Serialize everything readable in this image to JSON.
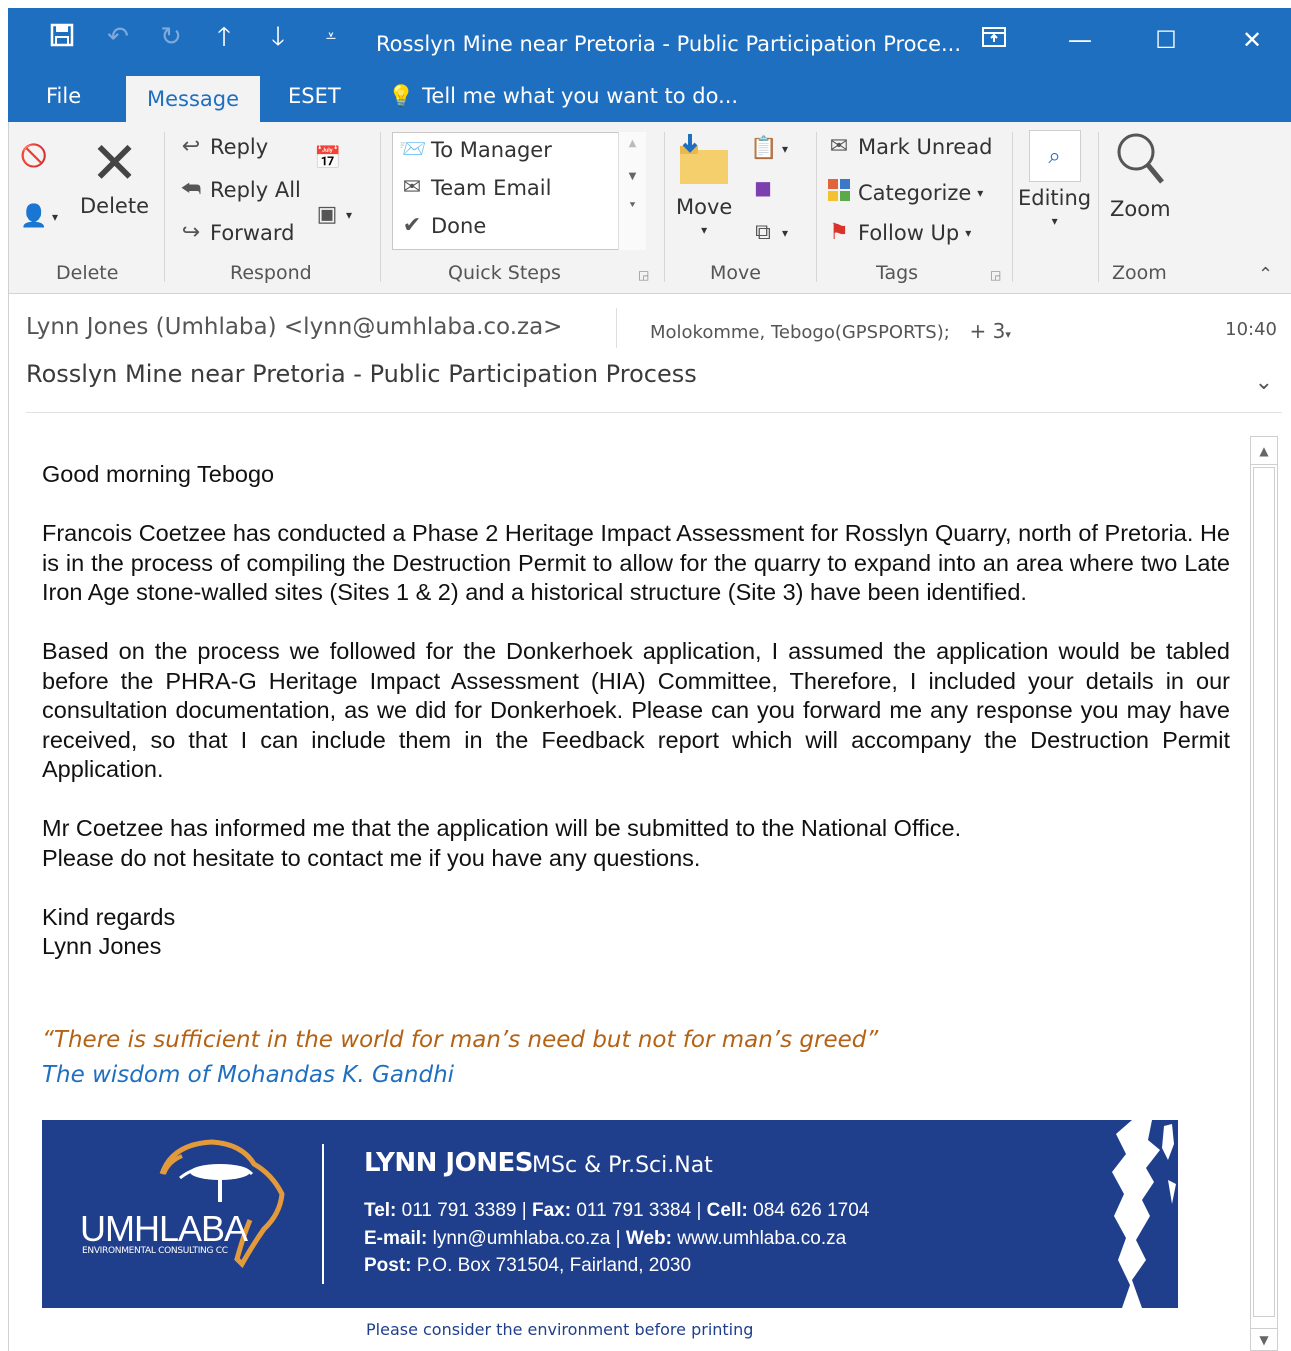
{
  "window": {
    "title": "Rosslyn Mine near Pretoria - Public Participation Proce...",
    "quick_access": [
      "save-icon",
      "undo-icon",
      "redo-icon",
      "up-arrow-icon",
      "down-arrow-icon",
      "customize-icon"
    ]
  },
  "tabs": {
    "file": "File",
    "message": "Message",
    "eset": "ESET",
    "tellme": "Tell me what you want to do..."
  },
  "ribbon": {
    "delete": {
      "delete_label": "Delete",
      "group": "Delete"
    },
    "respond": {
      "reply": "Reply",
      "reply_all": "Reply All",
      "forward": "Forward",
      "group": "Respond"
    },
    "quick_steps": {
      "items": [
        "To Manager",
        "Team Email",
        "Done"
      ],
      "group": "Quick Steps"
    },
    "move": {
      "move_label": "Move",
      "group": "Move"
    },
    "tags": {
      "mark_unread": "Mark Unread",
      "categorize": "Categorize",
      "follow_up": "Follow Up",
      "group": "Tags"
    },
    "editing": {
      "label": "Editing"
    },
    "zoom": {
      "label": "Zoom",
      "group": "Zoom"
    }
  },
  "header": {
    "sender": "Lynn Jones (Umhlaba) <lynn@umhlaba.co.za>",
    "recipients": "Molokomme, Tebogo(GPSPORTS);",
    "more_recipients": "+ 3",
    "time": "10:40",
    "subject": "Rosslyn Mine near Pretoria - Public Participation Process"
  },
  "body": {
    "greeting": "Good morning Tebogo",
    "para1": "Francois Coetzee has conducted a Phase 2 Heritage Impact Assessment for Rosslyn Quarry, north of Pretoria.  He is in the process of compiling the Destruction Permit to allow for the quarry to expand into an area where two Late Iron Age stone-walled sites (Sites 1 & 2) and a historical structure (Site 3) have been identified.",
    "para2": "Based on the process we followed for the Donkerhoek application, I assumed the application would be tabled before the PHRA-G Heritage Impact Assessment (HIA) Committee, Therefore, I included your details in our consultation documentation, as we did for Donkerhoek.  Please can you forward me any response you may have received, so that I can include them in the Feedback report which will accompany the Destruction Permit Application.",
    "para3_line1": "Mr Coetzee has informed me that the application will be submitted to the National Office.",
    "para3_line2": "Please do not hesitate to contact me if you have any questions.",
    "closing": "Kind regards",
    "signoff": "Lynn Jones",
    "quote": "“There is sufficient in the world for man’s need but not for man’s greed”",
    "quote_attr": "The wisdom of Mohandas K. Gandhi"
  },
  "signature": {
    "logo_text": "UMHLABA",
    "logo_sub": "ENVIRONMENTAL CONSULTING CC",
    "name": "LYNN JONES",
    "credentials": "MSc & Pr.Sci.Nat",
    "tel_label": "Tel:",
    "tel": "011 791 3389",
    "fax_label": "Fax:",
    "fax": "011 791 3384",
    "cell_label": "Cell:",
    "cell": "084 626 1704",
    "email_label": "E-mail:",
    "email": "lynn@umhlaba.co.za",
    "web_label": "Web:",
    "web": "www.umhlaba.co.za",
    "post_label": "Post:",
    "post": "P.O. Box 731504, Fairland, 2030",
    "sep": "|",
    "footer": "Please consider the environment before printing"
  },
  "colors": {
    "accent": "#1f6fc1",
    "banner": "#1f3e8c",
    "quote": "#b46214",
    "ribbon_bg": "#f3f3f3"
  }
}
